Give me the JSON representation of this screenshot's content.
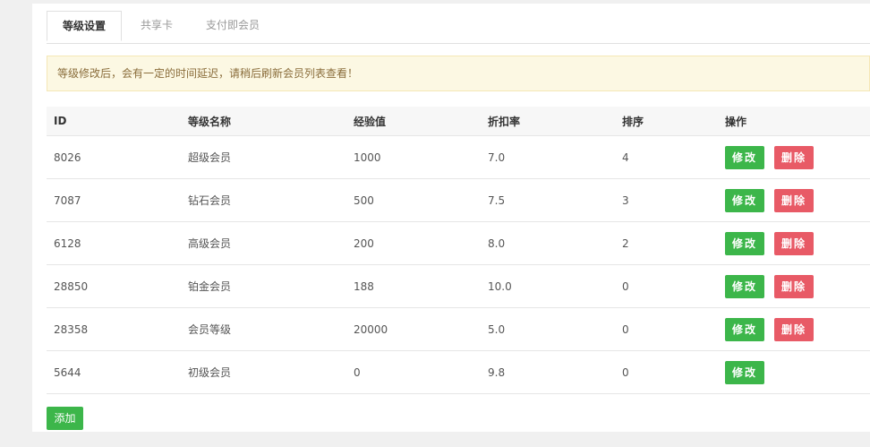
{
  "tabs": [
    {
      "label": "等级设置",
      "active": true
    },
    {
      "label": "共享卡",
      "active": false
    },
    {
      "label": "支付即会员",
      "active": false
    }
  ],
  "notice": "等级修改后，会有一定的时间延迟，请稍后刷新会员列表查看！",
  "table": {
    "headers": [
      "ID",
      "等级名称",
      "经验值",
      "折扣率",
      "排序",
      "操作"
    ],
    "rows": [
      {
        "id": "8026",
        "name": "超级会员",
        "exp": "1000",
        "discount": "7.0",
        "sort": "4",
        "deletable": true
      },
      {
        "id": "7087",
        "name": "钻石会员",
        "exp": "500",
        "discount": "7.5",
        "sort": "3",
        "deletable": true
      },
      {
        "id": "6128",
        "name": "高级会员",
        "exp": "200",
        "discount": "8.0",
        "sort": "2",
        "deletable": true
      },
      {
        "id": "28850",
        "name": "铂金会员",
        "exp": "188",
        "discount": "10.0",
        "sort": "0",
        "deletable": true
      },
      {
        "id": "28358",
        "name": "会员等级",
        "exp": "20000",
        "discount": "5.0",
        "sort": "0",
        "deletable": true
      },
      {
        "id": "5644",
        "name": "初级会员",
        "exp": "0",
        "discount": "9.8",
        "sort": "0",
        "deletable": false
      }
    ]
  },
  "actions": {
    "edit_label": "修改",
    "delete_label": "删除",
    "add_label": "添加"
  },
  "colors": {
    "edit": "#3cb64a",
    "delete": "#e85a66",
    "notice_bg": "#fcf8e3",
    "notice_text": "#8a6d3b"
  }
}
